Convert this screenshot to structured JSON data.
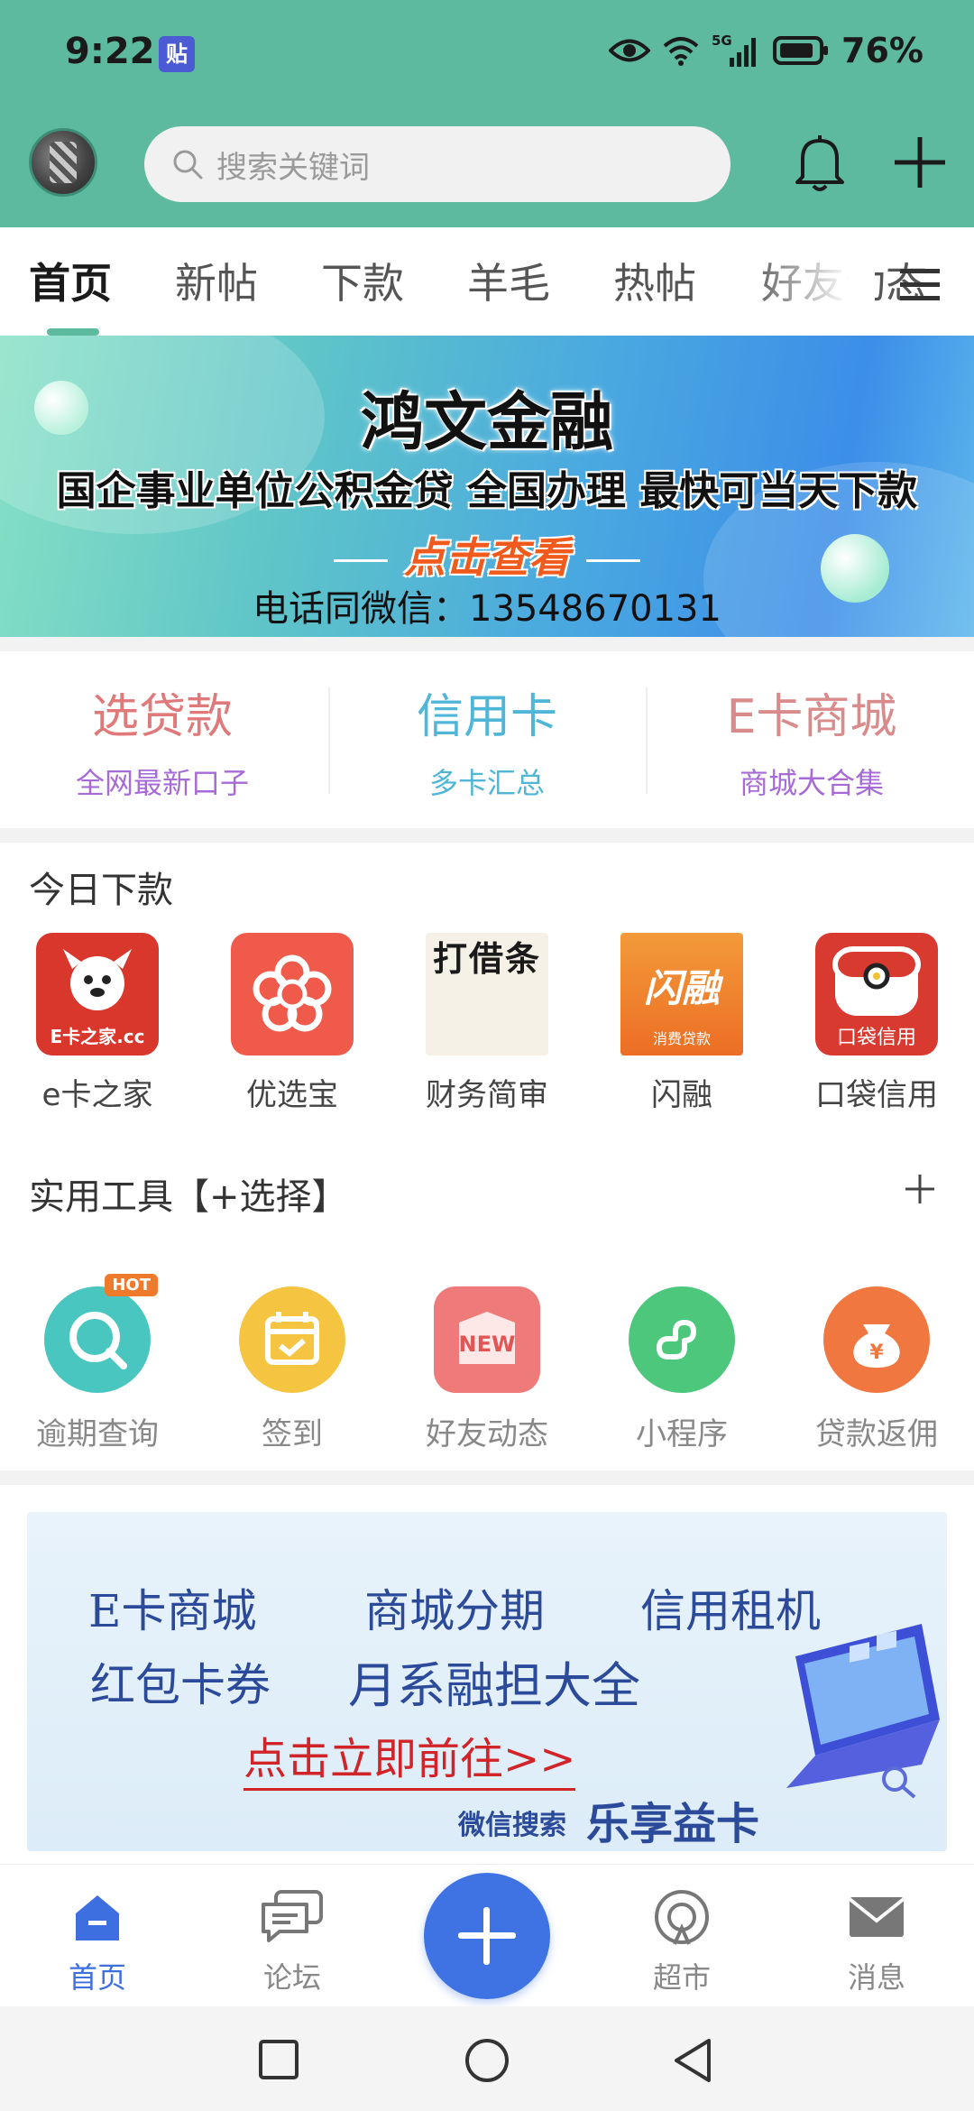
{
  "status_bar": {
    "time": "9:22",
    "notification_app": "贴",
    "network": "5G",
    "battery": "76%"
  },
  "search": {
    "placeholder": "搜索关键词"
  },
  "tabs": [
    {
      "label": "首页",
      "active": true
    },
    {
      "label": "新帖"
    },
    {
      "label": "下款"
    },
    {
      "label": "羊毛"
    },
    {
      "label": "热帖"
    },
    {
      "label": "好友动态"
    }
  ],
  "banner": {
    "title": "鸿文金融",
    "subtitle": "国企事业单位公积金贷 全国办理 最快可当天下款",
    "cta": "点击查看",
    "phone": "电话同微信：13548670131"
  },
  "quick_entries": [
    {
      "title": "选贷款",
      "subtitle": "全网最新口子",
      "title_color": "#e07a7a",
      "subtitle_color": "#a66bd6"
    },
    {
      "title": "信用卡",
      "subtitle": "多卡汇总",
      "title_color": "#4fb6d8",
      "subtitle_color": "#4fb6d8"
    },
    {
      "title": "E卡商城",
      "subtitle": "商城大合集",
      "title_color": "#d98a8a",
      "subtitle_color": "#a66bd6"
    }
  ],
  "today": {
    "title": "今日下款",
    "apps": [
      {
        "label": "e卡之家",
        "icon": "ecard-logo-icon",
        "badge": "E卡之家.cc"
      },
      {
        "label": "优选宝",
        "icon": "youxuanbao-logo-icon"
      },
      {
        "label": "财务简审",
        "icon": "daijietiao-logo-icon",
        "badge": "打借条"
      },
      {
        "label": "闪融",
        "icon": "shanrong-logo-icon",
        "badge": "闪融",
        "badge_sub": "消费贷款"
      },
      {
        "label": "口袋信用",
        "icon": "koudai-logo-icon",
        "badge": "口袋信用"
      }
    ]
  },
  "tools": {
    "title": "实用工具【+选择】",
    "items": [
      {
        "label": "逾期查询",
        "icon": "search-icon",
        "color": "#48c6bf",
        "hot": "HOT"
      },
      {
        "label": "签到",
        "icon": "calendar-check-icon",
        "color": "#f5c542"
      },
      {
        "label": "好友动态",
        "icon": "new-tag-icon",
        "color": "#ee7a7a",
        "tag": "NEW"
      },
      {
        "label": "小程序",
        "icon": "mini-program-icon",
        "color": "#4cc77b"
      },
      {
        "label": "贷款返佣",
        "icon": "money-bag-icon",
        "color": "#f0773f"
      }
    ]
  },
  "promo": {
    "line1": [
      "E卡商城",
      "商城分期",
      "信用租机"
    ],
    "line2": [
      "红包卡券",
      "月系融担大全"
    ],
    "cta": "点击立即前往>>",
    "search_hint": "微信搜索",
    "brand": "乐享益卡"
  },
  "bottom_nav": [
    {
      "label": "首页",
      "icon": "home-icon",
      "active": true
    },
    {
      "label": "论坛",
      "icon": "forum-icon"
    },
    {
      "label": "超市",
      "icon": "market-icon"
    },
    {
      "label": "消息",
      "icon": "mail-icon"
    }
  ],
  "colors": {
    "header": "#5dba9f",
    "accent": "#3f73e4"
  }
}
